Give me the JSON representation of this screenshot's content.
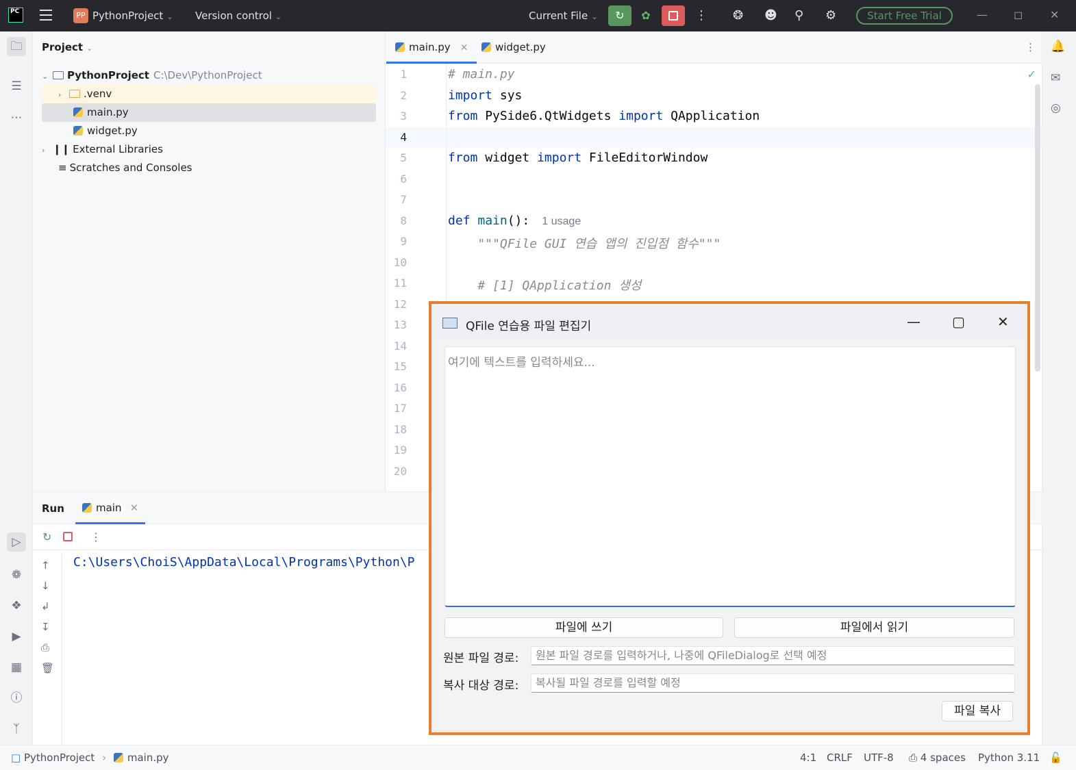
{
  "titlebar": {
    "logo_text": "PC",
    "project_badge": "PP",
    "project_name": "PythonProject",
    "version_control": "Version control",
    "run_config": "Current File",
    "trial_button": "Start Free Trial"
  },
  "project_panel": {
    "title": "Project",
    "tree": [
      {
        "label": "PythonProject",
        "path": "C:\\Dev\\PythonProject"
      },
      {
        "label": ".venv"
      },
      {
        "label": "main.py"
      },
      {
        "label": "widget.py"
      },
      {
        "label": "External Libraries"
      },
      {
        "label": "Scratches and Consoles"
      }
    ]
  },
  "editor": {
    "tabs": [
      {
        "label": "main.py"
      },
      {
        "label": "widget.py"
      }
    ],
    "line_numbers": [
      "1",
      "2",
      "3",
      "4",
      "5",
      "6",
      "7",
      "8",
      "9",
      "10",
      "11",
      "12",
      "13",
      "14",
      "15",
      "16",
      "17",
      "18",
      "19",
      "20"
    ],
    "lines": {
      "l1": "# main.py",
      "l2a": "import",
      "l2b": " sys",
      "l3a": "from",
      "l3b": " PySide6.QtWidgets ",
      "l3c": "import",
      "l3d": " QApplication",
      "l5a": "from",
      "l5b": " widget ",
      "l5c": "import",
      "l5d": " FileEditorWindow",
      "l8a": "def",
      "l8b": " main",
      "l8c": "():",
      "l8hint": "1 usage",
      "l9": "    \"\"\"QFile GUI 연습 앱의 진입점 함수\"\"\"",
      "l11": "    # [1] QApplication 생성"
    }
  },
  "run_panel": {
    "title": "Run",
    "tab": "main",
    "console_line": "C:\\Users\\ChoiS\\AppData\\Local\\Programs\\Python\\P"
  },
  "statusbar": {
    "crumb_project": "PythonProject",
    "crumb_file": "main.py",
    "position": "4:1",
    "line_sep": "CRLF",
    "encoding": "UTF-8",
    "indent": "4 spaces",
    "interpreter": "Python 3.11"
  },
  "dialog": {
    "title": "QFile 연습용 파일 편집기",
    "text_placeholder": "여기에 텍스트를 입력하세요...",
    "write_button": "파일에 쓰기",
    "read_button": "파일에서 읽기",
    "source_label": "원본 파일 경로:",
    "source_placeholder": "원본 파일 경로를 입력하거나, 나중에 QFileDialog로 선택 예정",
    "target_label": "복사 대상 경로:",
    "target_placeholder": "복사될 파일 경로를 입력할 예정",
    "copy_button": "파일 복사"
  },
  "colors": {
    "accent": "#3574f0",
    "highlight_frame": "#e77f2d",
    "run_green": "#57965c",
    "stop_red": "#db5c5c"
  }
}
